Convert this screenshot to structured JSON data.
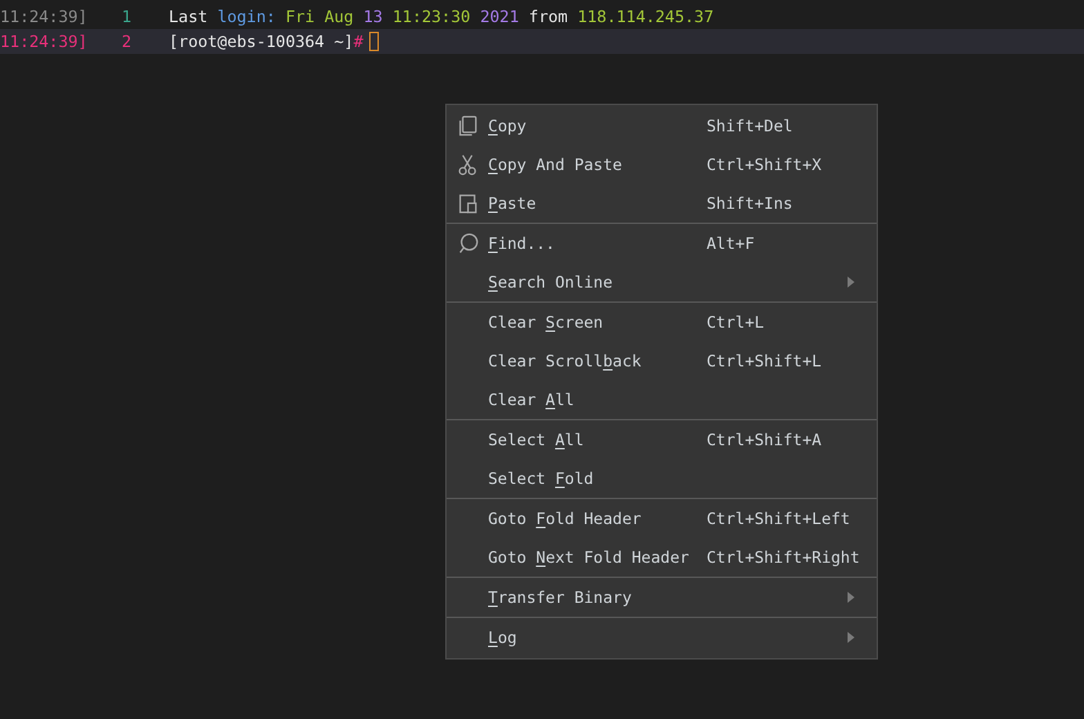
{
  "terminal": {
    "lines": [
      {
        "timestamp": "11:24:39]",
        "number": "1",
        "current": false,
        "cursor": false,
        "tokens": [
          {
            "text": "Last ",
            "color": "#e6e6e6"
          },
          {
            "text": "login: ",
            "color": "#5f9be3"
          },
          {
            "text": "Fri Aug ",
            "color": "#a3c738"
          },
          {
            "text": "13 ",
            "color": "#a47ae6"
          },
          {
            "text": "11:23:30 ",
            "color": "#a3c738"
          },
          {
            "text": "2021 ",
            "color": "#a47ae6"
          },
          {
            "text": "from ",
            "color": "#e6e6e6"
          },
          {
            "text": "118.114.245.37",
            "color": "#a3c738"
          }
        ]
      },
      {
        "timestamp": "11:24:39]",
        "number": "2",
        "current": true,
        "cursor": true,
        "tokens": [
          {
            "text": "[root@ebs-100364 ~]",
            "color": "#e6e6e6"
          },
          {
            "text": "#",
            "color": "#e8307a"
          }
        ]
      }
    ]
  },
  "context_menu": {
    "sections": [
      [
        {
          "key": "C",
          "after": "opy",
          "shortcut": "Shift+Del",
          "submenu": false
        },
        {
          "key": "C",
          "after": "opy And Paste",
          "shortcut": "Ctrl+Shift+X",
          "submenu": false
        },
        {
          "key": "P",
          "after": "aste",
          "shortcut": "Shift+Ins",
          "submenu": false
        }
      ],
      [
        {
          "key": "F",
          "after": "ind...",
          "shortcut": "Alt+F",
          "submenu": false
        },
        {
          "key": "S",
          "after": "earch Online",
          "submenu": true
        }
      ],
      [
        {
          "before": "Clear ",
          "key": "S",
          "after": "creen",
          "shortcut": "Ctrl+L",
          "submenu": false
        },
        {
          "before": "Clear Scroll",
          "key": "b",
          "after": "ack",
          "shortcut": "Ctrl+Shift+L",
          "submenu": false
        },
        {
          "before": "Clear ",
          "key": "A",
          "after": "ll",
          "submenu": false
        }
      ],
      [
        {
          "before": "Select ",
          "key": "A",
          "after": "ll",
          "shortcut": "Ctrl+Shift+A",
          "submenu": false
        },
        {
          "before": "Select ",
          "key": "F",
          "after": "old",
          "submenu": false
        }
      ],
      [
        {
          "before": "Goto ",
          "key": "F",
          "after": "old Header",
          "shortcut": "Ctrl+Shift+Left",
          "submenu": false
        },
        {
          "before": "Goto ",
          "key": "N",
          "after": "ext Fold Header",
          "shortcut": "Ctrl+Shift+Right",
          "submenu": false
        }
      ],
      [
        {
          "key": "T",
          "after": "ransfer Binary",
          "submenu": true
        }
      ],
      [
        {
          "key": "L",
          "after": "og",
          "submenu": true
        }
      ]
    ]
  }
}
